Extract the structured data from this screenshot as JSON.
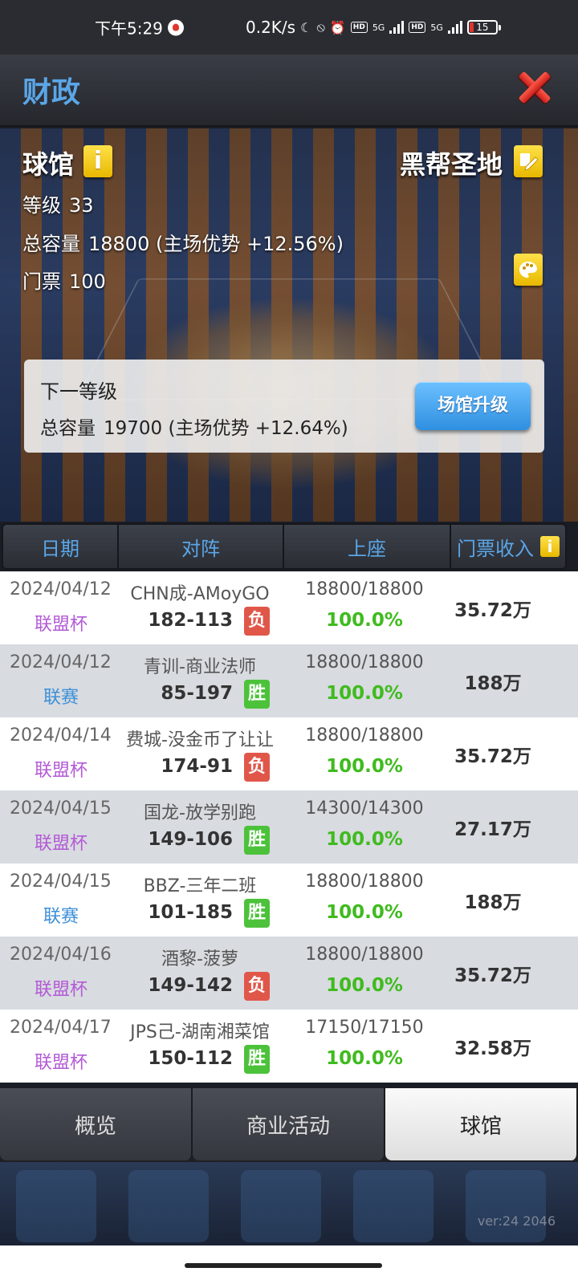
{
  "status_bar": {
    "time": "下午5:29",
    "net_speed": "0.2K/s",
    "signal_1": "5G",
    "signal_2": "5G",
    "battery": "15"
  },
  "header": {
    "title": "财政"
  },
  "arena": {
    "name": "球馆",
    "owner_name": "黑帮圣地",
    "level_label": "等级",
    "level_value": "33",
    "capacity_label": "总容量",
    "capacity_value": "18800 (主场优势 +12.56%)",
    "ticket_label": "门票",
    "ticket_value": "100"
  },
  "next_level": {
    "heading": "下一等级",
    "capacity_label": "总容量",
    "capacity_value": "19700 (主场优势 +12.64%)",
    "upgrade_button": "场馆升级"
  },
  "table": {
    "headers": [
      "日期",
      "对阵",
      "上座",
      "门票收入"
    ],
    "rows": [
      {
        "date": "2024/04/12",
        "competition": "联盟杯",
        "match": "CHN成-AMoyGO",
        "score": "182-113",
        "result": "负",
        "attendance": "18800/18800",
        "rate": "100.0%",
        "revenue": "35.72万"
      },
      {
        "date": "2024/04/12",
        "competition": "联赛",
        "match": "青训-商业法师",
        "score": "85-197",
        "result": "胜",
        "attendance": "18800/18800",
        "rate": "100.0%",
        "revenue": "188万"
      },
      {
        "date": "2024/04/14",
        "competition": "联盟杯",
        "match": "费城-没金币了让让",
        "score": "174-91",
        "result": "负",
        "attendance": "18800/18800",
        "rate": "100.0%",
        "revenue": "35.72万"
      },
      {
        "date": "2024/04/15",
        "competition": "联盟杯",
        "match": "国龙-放学别跑",
        "score": "149-106",
        "result": "胜",
        "attendance": "14300/14300",
        "rate": "100.0%",
        "revenue": "27.17万"
      },
      {
        "date": "2024/04/15",
        "competition": "联赛",
        "match": "BBZ-三年二班",
        "score": "101-185",
        "result": "胜",
        "attendance": "18800/18800",
        "rate": "100.0%",
        "revenue": "188万"
      },
      {
        "date": "2024/04/16",
        "competition": "联盟杯",
        "match": "酒黎-菠萝",
        "score": "149-142",
        "result": "负",
        "attendance": "18800/18800",
        "rate": "100.0%",
        "revenue": "35.72万"
      },
      {
        "date": "2024/04/17",
        "competition": "联盟杯",
        "match": "JPS己-湖南湘菜馆",
        "score": "150-112",
        "result": "胜",
        "attendance": "17150/17150",
        "rate": "100.0%",
        "revenue": "32.58万"
      }
    ]
  },
  "tabs": [
    {
      "label": "概览",
      "active": false
    },
    {
      "label": "商业活动",
      "active": false
    },
    {
      "label": "球馆",
      "active": true
    }
  ],
  "version": "ver:24 2046",
  "colors": {
    "title_blue": "#5aa6e8",
    "cup_purple": "#b35ad6",
    "league_blue": "#3c8fd8",
    "win_green": "#4cc23a",
    "loss_red": "#e0574a",
    "rate_green": "#3fbb1e"
  }
}
